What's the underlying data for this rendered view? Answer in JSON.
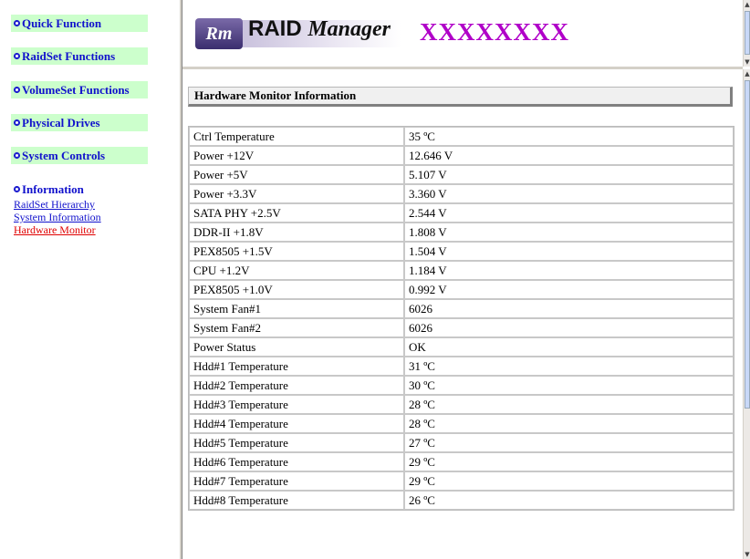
{
  "nav": {
    "groups": [
      {
        "label": "Quick Function"
      },
      {
        "label": "RaidSet Functions"
      },
      {
        "label": "VolumeSet Functions"
      },
      {
        "label": "Physical Drives"
      },
      {
        "label": "System Controls"
      },
      {
        "label": "Information"
      }
    ],
    "info_links": [
      "RaidSet Hierarchy",
      "System Information",
      "Hardware Monitor"
    ],
    "active_link": "Hardware Monitor"
  },
  "banner": {
    "logo_mark": "Rm",
    "logo_word1": "RAID",
    "logo_word2": "Manager",
    "title": "XXXXXXXX"
  },
  "section": {
    "title": "Hardware Monitor Information"
  },
  "rows": [
    {
      "label": "Ctrl Temperature",
      "value": "35 ºC"
    },
    {
      "label": "Power +12V",
      "value": "12.646 V"
    },
    {
      "label": "Power +5V",
      "value": "5.107 V"
    },
    {
      "label": "Power +3.3V",
      "value": "3.360 V"
    },
    {
      "label": "SATA PHY +2.5V",
      "value": "2.544 V"
    },
    {
      "label": "DDR-II +1.8V",
      "value": "1.808 V"
    },
    {
      "label": "PEX8505 +1.5V",
      "value": "1.504 V"
    },
    {
      "label": "CPU +1.2V",
      "value": "1.184 V"
    },
    {
      "label": "PEX8505 +1.0V",
      "value": "0.992 V"
    },
    {
      "label": "System Fan#1",
      "value": "6026"
    },
    {
      "label": "System Fan#2",
      "value": "6026"
    },
    {
      "label": "Power Status",
      "value": "OK"
    },
    {
      "label": "Hdd#1 Temperature",
      "value": "31 ºC"
    },
    {
      "label": "Hdd#2 Temperature",
      "value": "30 ºC"
    },
    {
      "label": "Hdd#3 Temperature",
      "value": "28 ºC"
    },
    {
      "label": "Hdd#4 Temperature",
      "value": "28 ºC"
    },
    {
      "label": "Hdd#5 Temperature",
      "value": "27 ºC"
    },
    {
      "label": "Hdd#6 Temperature",
      "value": "29 ºC"
    },
    {
      "label": "Hdd#7 Temperature",
      "value": "29 ºC"
    },
    {
      "label": "Hdd#8 Temperature",
      "value": "26 ºC"
    }
  ],
  "colors": {
    "nav_header_bg": "#ccffcc",
    "nav_link": "#1111cc",
    "active_link": "#e00000",
    "banner_title": "#b000c8"
  }
}
